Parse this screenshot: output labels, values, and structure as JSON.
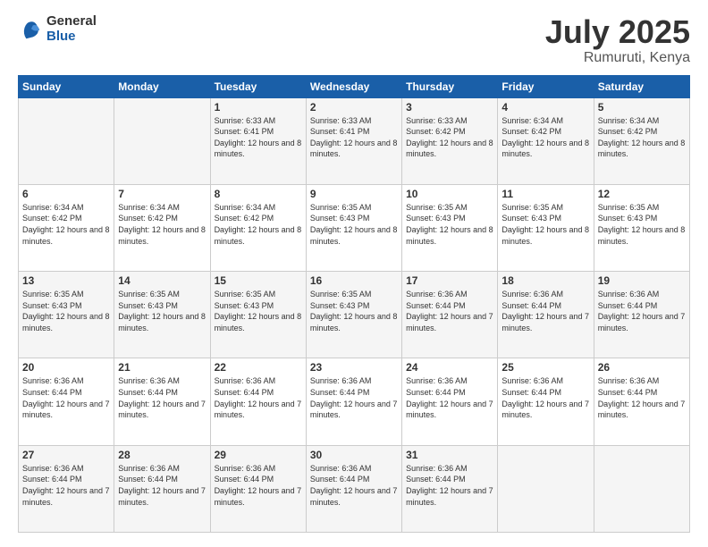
{
  "logo": {
    "general": "General",
    "blue": "Blue"
  },
  "title": "July 2025",
  "location": "Rumuruti, Kenya",
  "days_header": [
    "Sunday",
    "Monday",
    "Tuesday",
    "Wednesday",
    "Thursday",
    "Friday",
    "Saturday"
  ],
  "weeks": [
    [
      {
        "day": "",
        "sunrise": "",
        "sunset": "",
        "daylight": ""
      },
      {
        "day": "",
        "sunrise": "",
        "sunset": "",
        "daylight": ""
      },
      {
        "day": "1",
        "sunrise": "Sunrise: 6:33 AM",
        "sunset": "Sunset: 6:41 PM",
        "daylight": "Daylight: 12 hours and 8 minutes."
      },
      {
        "day": "2",
        "sunrise": "Sunrise: 6:33 AM",
        "sunset": "Sunset: 6:41 PM",
        "daylight": "Daylight: 12 hours and 8 minutes."
      },
      {
        "day": "3",
        "sunrise": "Sunrise: 6:33 AM",
        "sunset": "Sunset: 6:42 PM",
        "daylight": "Daylight: 12 hours and 8 minutes."
      },
      {
        "day": "4",
        "sunrise": "Sunrise: 6:34 AM",
        "sunset": "Sunset: 6:42 PM",
        "daylight": "Daylight: 12 hours and 8 minutes."
      },
      {
        "day": "5",
        "sunrise": "Sunrise: 6:34 AM",
        "sunset": "Sunset: 6:42 PM",
        "daylight": "Daylight: 12 hours and 8 minutes."
      }
    ],
    [
      {
        "day": "6",
        "sunrise": "Sunrise: 6:34 AM",
        "sunset": "Sunset: 6:42 PM",
        "daylight": "Daylight: 12 hours and 8 minutes."
      },
      {
        "day": "7",
        "sunrise": "Sunrise: 6:34 AM",
        "sunset": "Sunset: 6:42 PM",
        "daylight": "Daylight: 12 hours and 8 minutes."
      },
      {
        "day": "8",
        "sunrise": "Sunrise: 6:34 AM",
        "sunset": "Sunset: 6:42 PM",
        "daylight": "Daylight: 12 hours and 8 minutes."
      },
      {
        "day": "9",
        "sunrise": "Sunrise: 6:35 AM",
        "sunset": "Sunset: 6:43 PM",
        "daylight": "Daylight: 12 hours and 8 minutes."
      },
      {
        "day": "10",
        "sunrise": "Sunrise: 6:35 AM",
        "sunset": "Sunset: 6:43 PM",
        "daylight": "Daylight: 12 hours and 8 minutes."
      },
      {
        "day": "11",
        "sunrise": "Sunrise: 6:35 AM",
        "sunset": "Sunset: 6:43 PM",
        "daylight": "Daylight: 12 hours and 8 minutes."
      },
      {
        "day": "12",
        "sunrise": "Sunrise: 6:35 AM",
        "sunset": "Sunset: 6:43 PM",
        "daylight": "Daylight: 12 hours and 8 minutes."
      }
    ],
    [
      {
        "day": "13",
        "sunrise": "Sunrise: 6:35 AM",
        "sunset": "Sunset: 6:43 PM",
        "daylight": "Daylight: 12 hours and 8 minutes."
      },
      {
        "day": "14",
        "sunrise": "Sunrise: 6:35 AM",
        "sunset": "Sunset: 6:43 PM",
        "daylight": "Daylight: 12 hours and 8 minutes."
      },
      {
        "day": "15",
        "sunrise": "Sunrise: 6:35 AM",
        "sunset": "Sunset: 6:43 PM",
        "daylight": "Daylight: 12 hours and 8 minutes."
      },
      {
        "day": "16",
        "sunrise": "Sunrise: 6:35 AM",
        "sunset": "Sunset: 6:43 PM",
        "daylight": "Daylight: 12 hours and 8 minutes."
      },
      {
        "day": "17",
        "sunrise": "Sunrise: 6:36 AM",
        "sunset": "Sunset: 6:44 PM",
        "daylight": "Daylight: 12 hours and 7 minutes."
      },
      {
        "day": "18",
        "sunrise": "Sunrise: 6:36 AM",
        "sunset": "Sunset: 6:44 PM",
        "daylight": "Daylight: 12 hours and 7 minutes."
      },
      {
        "day": "19",
        "sunrise": "Sunrise: 6:36 AM",
        "sunset": "Sunset: 6:44 PM",
        "daylight": "Daylight: 12 hours and 7 minutes."
      }
    ],
    [
      {
        "day": "20",
        "sunrise": "Sunrise: 6:36 AM",
        "sunset": "Sunset: 6:44 PM",
        "daylight": "Daylight: 12 hours and 7 minutes."
      },
      {
        "day": "21",
        "sunrise": "Sunrise: 6:36 AM",
        "sunset": "Sunset: 6:44 PM",
        "daylight": "Daylight: 12 hours and 7 minutes."
      },
      {
        "day": "22",
        "sunrise": "Sunrise: 6:36 AM",
        "sunset": "Sunset: 6:44 PM",
        "daylight": "Daylight: 12 hours and 7 minutes."
      },
      {
        "day": "23",
        "sunrise": "Sunrise: 6:36 AM",
        "sunset": "Sunset: 6:44 PM",
        "daylight": "Daylight: 12 hours and 7 minutes."
      },
      {
        "day": "24",
        "sunrise": "Sunrise: 6:36 AM",
        "sunset": "Sunset: 6:44 PM",
        "daylight": "Daylight: 12 hours and 7 minutes."
      },
      {
        "day": "25",
        "sunrise": "Sunrise: 6:36 AM",
        "sunset": "Sunset: 6:44 PM",
        "daylight": "Daylight: 12 hours and 7 minutes."
      },
      {
        "day": "26",
        "sunrise": "Sunrise: 6:36 AM",
        "sunset": "Sunset: 6:44 PM",
        "daylight": "Daylight: 12 hours and 7 minutes."
      }
    ],
    [
      {
        "day": "27",
        "sunrise": "Sunrise: 6:36 AM",
        "sunset": "Sunset: 6:44 PM",
        "daylight": "Daylight: 12 hours and 7 minutes."
      },
      {
        "day": "28",
        "sunrise": "Sunrise: 6:36 AM",
        "sunset": "Sunset: 6:44 PM",
        "daylight": "Daylight: 12 hours and 7 minutes."
      },
      {
        "day": "29",
        "sunrise": "Sunrise: 6:36 AM",
        "sunset": "Sunset: 6:44 PM",
        "daylight": "Daylight: 12 hours and 7 minutes."
      },
      {
        "day": "30",
        "sunrise": "Sunrise: 6:36 AM",
        "sunset": "Sunset: 6:44 PM",
        "daylight": "Daylight: 12 hours and 7 minutes."
      },
      {
        "day": "31",
        "sunrise": "Sunrise: 6:36 AM",
        "sunset": "Sunset: 6:44 PM",
        "daylight": "Daylight: 12 hours and 7 minutes."
      },
      {
        "day": "",
        "sunrise": "",
        "sunset": "",
        "daylight": ""
      },
      {
        "day": "",
        "sunrise": "",
        "sunset": "",
        "daylight": ""
      }
    ]
  ]
}
